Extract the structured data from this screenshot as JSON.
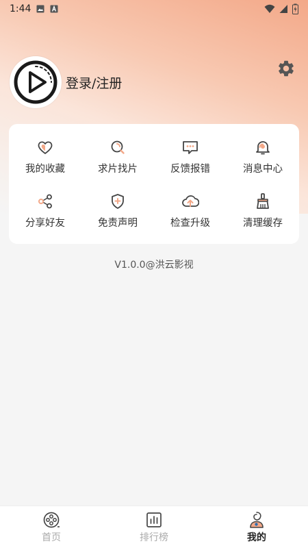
{
  "status_bar": {
    "time": "1:44",
    "notification_icons": [
      "image-icon",
      "text-a-icon"
    ],
    "system_icons": [
      "wifi-icon",
      "signal-icon",
      "battery-charging-icon"
    ]
  },
  "header": {
    "login_label": "登录/注册",
    "settings_icon": "gear-icon",
    "avatar_icon": "play-circle-icon"
  },
  "menu": {
    "items": [
      {
        "label": "我的收藏",
        "icon": "heart-icon"
      },
      {
        "label": "求片找片",
        "icon": "search-icon"
      },
      {
        "label": "反馈报错",
        "icon": "message-icon"
      },
      {
        "label": "消息中心",
        "icon": "bell-icon"
      },
      {
        "label": "分享好友",
        "icon": "share-icon"
      },
      {
        "label": "免责声明",
        "icon": "shield-icon"
      },
      {
        "label": "检查升级",
        "icon": "cloud-upload-icon"
      },
      {
        "label": "清理缓存",
        "icon": "broom-icon"
      }
    ]
  },
  "version_text": "V1.0.0@洪云影视",
  "bottom_nav": {
    "items": [
      {
        "label": "首页",
        "icon": "film-reel-icon",
        "active": false
      },
      {
        "label": "排行榜",
        "icon": "bar-chart-icon",
        "active": false
      },
      {
        "label": "我的",
        "icon": "person-icon",
        "active": true
      }
    ]
  },
  "colors": {
    "accent": "#f3a888",
    "accent_dark": "#e8875f",
    "background": "#f5f5f5"
  }
}
